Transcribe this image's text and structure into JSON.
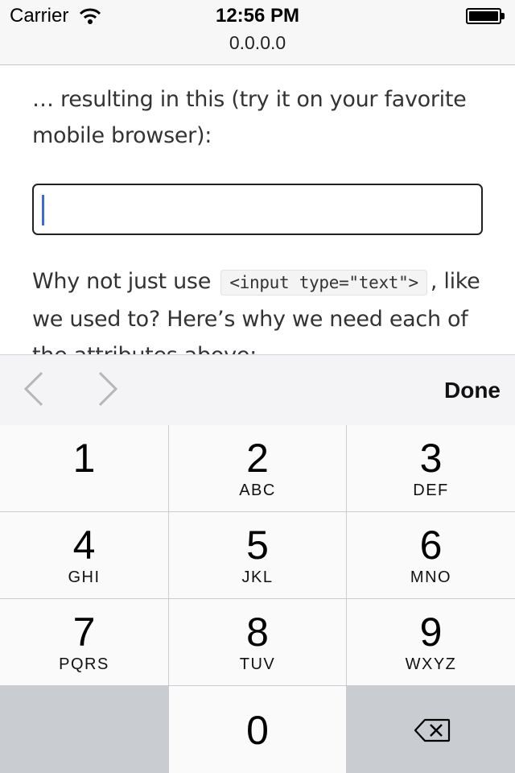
{
  "status_bar": {
    "carrier": "Carrier",
    "time": "12:56 PM",
    "url": "0.0.0.0",
    "wifi_icon": "wifi-icon",
    "battery_icon": "battery-icon"
  },
  "content": {
    "intro_text": "… resulting in this (try it on your favorite mobile browser):",
    "input_value": "",
    "para2_before": "Why not just use",
    "para2_code": "<input type=\"text\">",
    "para2_after": ", like we used to? Here’s why we need each of the attributes above:"
  },
  "accessory_bar": {
    "prev_icon": "chevron-left-icon",
    "next_icon": "chevron-right-icon",
    "done_label": "Done"
  },
  "keypad": {
    "keys": [
      {
        "digit": "1",
        "letters": ""
      },
      {
        "digit": "2",
        "letters": "ABC"
      },
      {
        "digit": "3",
        "letters": "DEF"
      },
      {
        "digit": "4",
        "letters": "GHI"
      },
      {
        "digit": "5",
        "letters": "JKL"
      },
      {
        "digit": "6",
        "letters": "MNO"
      },
      {
        "digit": "7",
        "letters": "PQRS"
      },
      {
        "digit": "8",
        "letters": "TUV"
      },
      {
        "digit": "9",
        "letters": "WXYZ"
      },
      {
        "digit": "0",
        "letters": ""
      }
    ],
    "delete_icon": "backspace-icon"
  },
  "colors": {
    "caret": "#3d6bd9",
    "keypad_background": "#c9ccd1",
    "key_background": "#fafafa"
  }
}
